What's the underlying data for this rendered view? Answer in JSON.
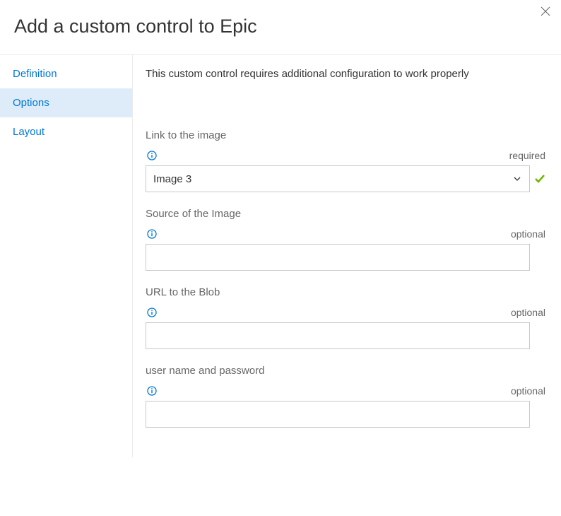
{
  "header": {
    "title": "Add a custom control to Epic"
  },
  "sidebar": {
    "tabs": [
      {
        "label": "Definition",
        "active": false
      },
      {
        "label": "Options",
        "active": true
      },
      {
        "label": "Layout",
        "active": false
      }
    ]
  },
  "content": {
    "intro": "This custom control requires additional configuration to work properly",
    "fields": [
      {
        "label": "Link to the image",
        "requirement": "required",
        "type": "select",
        "value": "Image 3",
        "valid": true
      },
      {
        "label": "Source of the Image",
        "requirement": "optional",
        "type": "text",
        "value": ""
      },
      {
        "label": "URL to the Blob",
        "requirement": "optional",
        "type": "text",
        "value": ""
      },
      {
        "label": "user name and password",
        "requirement": "optional",
        "type": "text",
        "value": ""
      }
    ]
  },
  "icons": {
    "close": "close-icon",
    "info": "info-icon",
    "chevron": "chevron-down-icon",
    "check": "check-icon"
  }
}
